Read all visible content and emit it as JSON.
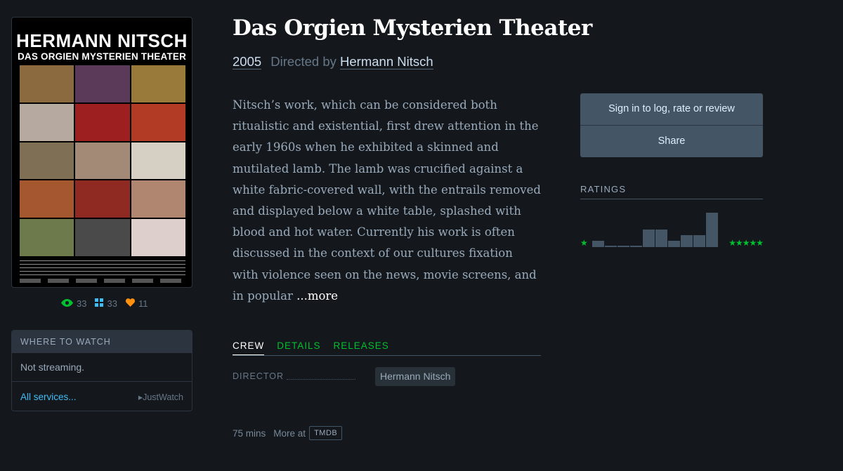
{
  "poster": {
    "title_line1": "HERMANN NITSCH",
    "title_line2": "DAS ORGIEN MYSTERIEN THEATER",
    "tile_colors": [
      "#8a6a3e",
      "#5a3a58",
      "#9a7a3a",
      "#b5a9a0",
      "#9e1f1f",
      "#b23b26",
      "#7e6f55",
      "#a38a77",
      "#d6d0c4",
      "#a5572f",
      "#8f2a22",
      "#b08670",
      "#6d7a4b",
      "#4a4a4a",
      "#ddd0cc"
    ]
  },
  "stats": {
    "watched_count": "33",
    "lists_count": "33",
    "likes_count": "11"
  },
  "where_to_watch": {
    "heading": "WHERE TO WATCH",
    "status": "Not streaming.",
    "all_services": "All services...",
    "provider": "JustWatch"
  },
  "film": {
    "title": "Das Orgien Mysterien Theater",
    "year": "2005",
    "directed_by": "Directed by",
    "director": "Hermann Nitsch"
  },
  "synopsis": {
    "text": "Nitsch’s work, which can be considered both ritualistic and existential, first drew attention in the early 1960s when he exhibited a skinned and mutilated lamb. The lamb was crucified against a white fabric-covered wall, with the entrails removed and displayed below a white table, splashed with blood and hot water. Currently his work is often discussed in the context of our cultures fixation with violence seen on the news, movie screens, and in popular",
    "more": "...more"
  },
  "actions": {
    "sign_in": "Sign in to log, rate or review",
    "share": "Share"
  },
  "ratings": {
    "label": "RATINGS",
    "histogram": [
      0.17,
      0.04,
      0.04,
      0.04,
      0.49,
      0.49,
      0.17,
      0.33,
      0.33,
      0.94
    ],
    "star_low": "★",
    "star_high": "★★★★★"
  },
  "tabs": [
    {
      "label": "CREW"
    },
    {
      "label": "DETAILS"
    },
    {
      "label": "RELEASES"
    }
  ],
  "crew": {
    "role": "DIRECTOR",
    "name": "Hermann Nitsch"
  },
  "footer": {
    "runtime": "75 mins",
    "more_at": "More at",
    "tmdb": "TMDB"
  },
  "colors": {
    "background": "#14181c",
    "accent_green": "#00c030",
    "accent_blue": "#40bcf4",
    "accent_orange": "#ff9010",
    "panel": "#456"
  }
}
